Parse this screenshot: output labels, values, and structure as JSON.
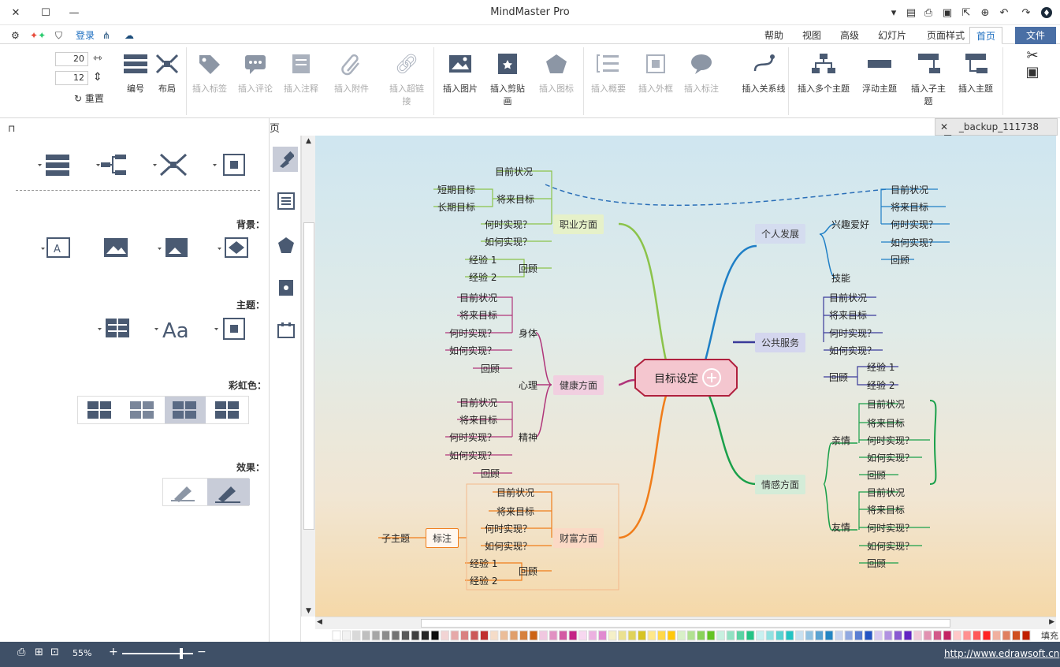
{
  "app": {
    "title": "MindMaster Pro"
  },
  "tabs": [
    "文件",
    "首页",
    "页面样式",
    "幻灯片",
    "高级",
    "视图",
    "帮助"
  ],
  "quickbar": {
    "login": "登录"
  },
  "ribbon": {
    "groups": [
      {
        "label": "插入主题"
      },
      {
        "label": "插入子主题"
      },
      {
        "label": "浮动主题"
      },
      {
        "label": "插入多个主题"
      },
      {
        "label": "插入关系线"
      },
      {
        "label": "插入标注"
      },
      {
        "label": "插入外框"
      },
      {
        "label": "插入概要"
      },
      {
        "label": "插入图标"
      },
      {
        "label": "插入剪贴画"
      },
      {
        "label": "插入图片"
      },
      {
        "label": "插入超链接"
      },
      {
        "label": "插入附件"
      },
      {
        "label": "插入注释"
      },
      {
        "label": "插入评论"
      },
      {
        "label": "插入标签"
      },
      {
        "label": "布局"
      },
      {
        "label": "编号"
      }
    ],
    "spin1": "20",
    "spin2": "12",
    "reset": "重置"
  },
  "leftpane": {
    "title": "页面",
    "bg_label": "背景：",
    "theme_label": "主题：",
    "rainbow_label": "彩虹色：",
    "effect_label": "效果："
  },
  "doc_tab": "_backup_111738",
  "mindmap": {
    "center": "目标设定",
    "left_topics": [
      {
        "label": "职业方面",
        "children": [
          "目前状况",
          "将来目标",
          "何时实现？",
          "如何实现？",
          "回顾"
        ],
        "sub_goal": [
          "短期目标",
          "长期目标"
        ],
        "sub_review": [
          "经验 1",
          "经验 2"
        ]
      },
      {
        "label": "健康方面",
        "children": [
          "身体",
          "心理",
          "精神"
        ]
      },
      {
        "label": "财富方面",
        "children": [
          "目前状况",
          "将来目标",
          "何时实现？",
          "如何实现？",
          "回顾"
        ],
        "sub_review": [
          "经验 1",
          "经验 2"
        ]
      }
    ],
    "body_children": [
      "目前状况",
      "将来目标",
      "何时实现？",
      "如何实现？",
      "回顾"
    ],
    "spirit_children": [
      "目前状况",
      "将来目标",
      "何时实现？",
      "如何实现？",
      "回顾"
    ],
    "right_topics": [
      {
        "label": "个人发展",
        "children": [
          "兴趣爱好",
          "技能"
        ]
      },
      {
        "label": "公共服务",
        "children": [
          "目前状况",
          "将来目标",
          "何时实现？",
          "如何实现？",
          "回顾"
        ],
        "sub_review": [
          "经验 1",
          "经验 2"
        ]
      },
      {
        "label": "情感方面",
        "children": [
          "亲情",
          "友情"
        ]
      }
    ],
    "hobby_children": [
      "目前状况",
      "将来目标",
      "何时实现？",
      "如何实现？",
      "回顾"
    ],
    "family_children": [
      "目前状况",
      "将来目标",
      "何时实现？",
      "如何实现？",
      "回顾"
    ],
    "friend_children": [
      "目前状况",
      "将来目标",
      "何时实现？",
      "如何实现？",
      "回顾"
    ],
    "callout": "标注",
    "subtopic": "子主题"
  },
  "palette_label": "填充",
  "status": {
    "url": "http://www.edrawsoft.cn",
    "zoom": "55%"
  },
  "colors": {
    "accent": "#4a6fa5",
    "status": "#3f5067"
  }
}
